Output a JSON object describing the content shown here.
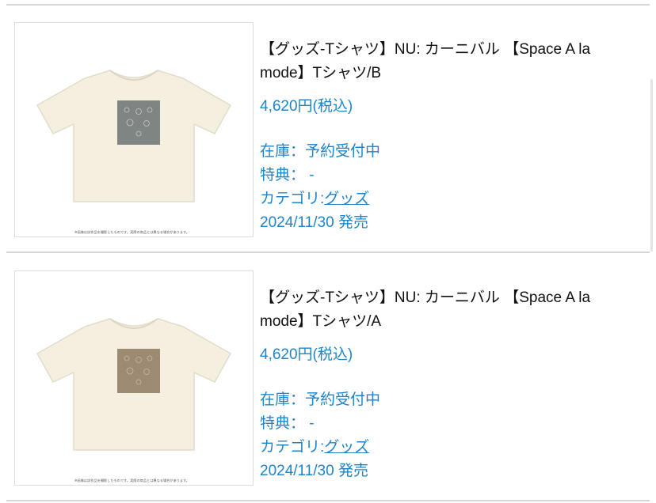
{
  "products": [
    {
      "title": "【グッズ-Tシャツ】NU: カーニバル 【Space A la mode】Tシャツ/B",
      "price": "4,620円(税込)",
      "stock": "在庫：予約受付中",
      "bonus": "特典： -",
      "category_prefix": "カテゴリ:",
      "category_link": "グッズ",
      "release": "2024/11/30 発売",
      "image_note": "※画像は試作品を撮影したものです。実際の商品とは異なる場合があります。",
      "print_color": "#7f8582"
    },
    {
      "title": "【グッズ-Tシャツ】NU: カーニバル 【Space A la mode】Tシャツ/A",
      "price": "4,620円(税込)",
      "stock": "在庫：予約受付中",
      "bonus": "特典： -",
      "category_prefix": "カテゴリ:",
      "category_link": "グッズ",
      "release": "2024/11/30 発売",
      "image_note": "※画像は試作品を撮影したものです。実際の商品とは異なる場合があります。",
      "print_color": "#9c8a73"
    }
  ],
  "colors": {
    "link": "#1f84c7",
    "shirt": "#f4efdf",
    "divider": "#d6d6d6"
  }
}
